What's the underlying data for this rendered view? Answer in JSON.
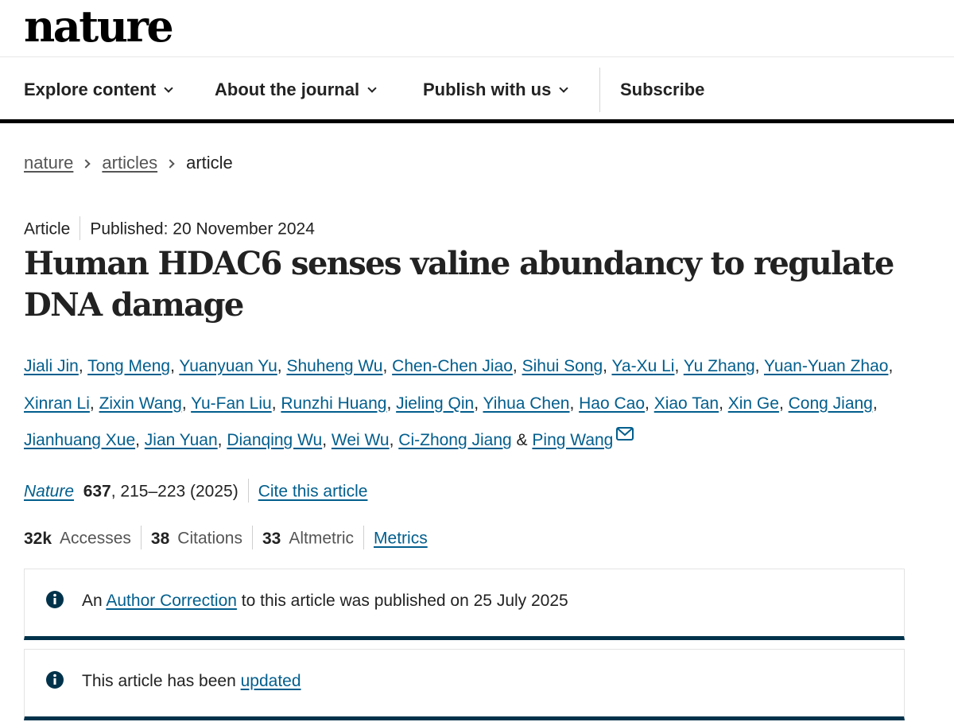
{
  "site": {
    "logo": "nature"
  },
  "nav": {
    "items": [
      {
        "label": "Explore content"
      },
      {
        "label": "About the journal"
      },
      {
        "label": "Publish with us"
      }
    ],
    "subscribe": "Subscribe"
  },
  "breadcrumb": {
    "home": "nature",
    "section": "articles",
    "current": "article"
  },
  "article": {
    "type": "Article",
    "published": "Published: 20 November 2024",
    "title": "Human HDAC6 senses valine abundancy to regulate DNA damage",
    "authors": [
      "Jiali Jin",
      "Tong Meng",
      "Yuanyuan Yu",
      "Shuheng Wu",
      "Chen-Chen Jiao",
      "Sihui Song",
      "Ya-Xu Li",
      "Yu Zhang",
      "Yuan-Yuan Zhao",
      "Xinran Li",
      "Zixin Wang",
      "Yu-Fan Liu",
      "Runzhi Huang",
      "Jieling Qin",
      "Yihua Chen",
      "Hao Cao",
      "Xiao Tan",
      "Xin Ge",
      "Cong Jiang",
      "Jianhuang Xue",
      "Jian Yuan",
      "Dianqing Wu",
      "Wei Wu",
      "Ci-Zhong Jiang",
      "Ping Wang"
    ],
    "authors_conjunction": "&",
    "journal": "Nature",
    "volume": "637",
    "pages_year": ", 215–223 (2025)",
    "cite_label": "Cite this article"
  },
  "metrics": {
    "accesses_value": "32k",
    "accesses_label": "Accesses",
    "citations_value": "38",
    "citations_label": "Citations",
    "altmetric_value": "33",
    "altmetric_label": "Altmetric",
    "metrics_link": "Metrics"
  },
  "notices": {
    "correction": {
      "prefix": "An",
      "link": "Author Correction",
      "suffix": "to this article was published on 25 July 2025"
    },
    "update": {
      "prefix": "This article has been",
      "link": "updated"
    }
  },
  "colors": {
    "link": "#025e8d",
    "notice_border": "#01324b",
    "text": "#222222"
  }
}
